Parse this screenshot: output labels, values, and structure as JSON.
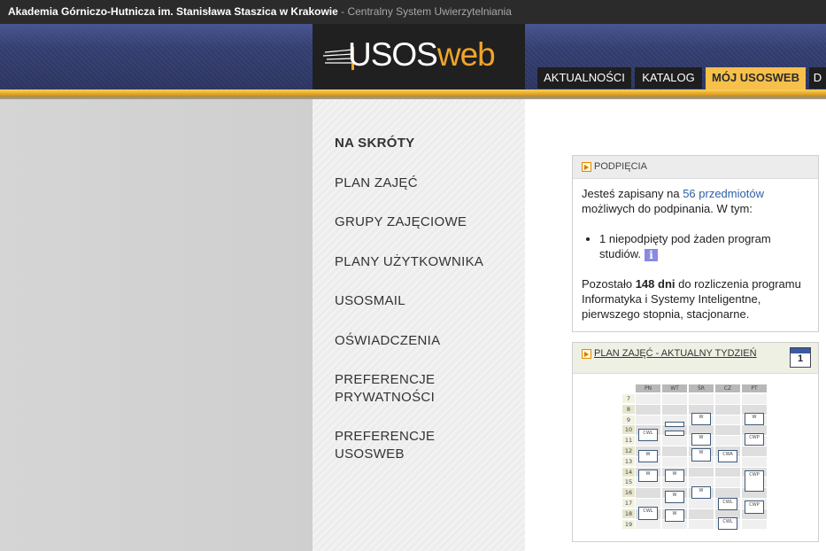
{
  "topbar": {
    "institution": "Akademia Górniczo-Hutnicza im. Stanisława Staszica w Krakowie",
    "system": " - Centralny System Uwierzytelniania"
  },
  "logo": {
    "part1": "USOS",
    "part2": "web"
  },
  "nav": {
    "tabs": [
      "AKTUALNOŚCI",
      "KATALOG",
      "MÓJ USOSWEB",
      "D"
    ],
    "active": "MÓJ USOSWEB"
  },
  "sidebar": {
    "items": [
      {
        "line1": "NA SKRÓTY",
        "line2": ""
      },
      {
        "line1": "PLAN ZAJĘĆ",
        "line2": ""
      },
      {
        "line1": "GRUPY ZAJĘCIOWE",
        "line2": ""
      },
      {
        "line1": "PLANY UŻYTKOWNIKA",
        "line2": ""
      },
      {
        "line1": "USOSMAIL",
        "line2": ""
      },
      {
        "line1": "OŚWIADCZENIA",
        "line2": ""
      },
      {
        "line1": "PREFERENCJE",
        "line2": "PRYWATNOŚCI"
      },
      {
        "line1": "PREFERENCJE",
        "line2": "USOSWEB"
      }
    ]
  },
  "panel_subscriptions": {
    "title": "PODPIĘCIA",
    "text1": "Jesteś zapisany na ",
    "link": "56 przedmiotów",
    "text2": " możliwych do podpinania. W tym:",
    "bullet": "1 niepodpięty pod żaden program studiów.",
    "info_icon": "i",
    "remaining_prefix": "Pozostało ",
    "remaining_days": "148 dni",
    "remaining_suffix": " do rozliczenia programu Informatyka i Systemy Inteligentne, pierwszego stopnia, stacjonarne."
  },
  "panel_plan": {
    "title": "PLAN ZAJĘĆ - AKTUALNY TYDZIEŃ",
    "calendar_day": "1",
    "days": [
      "PN",
      "WT",
      "ŚR",
      "CZ",
      "PT"
    ],
    "hours": [
      "7",
      "8",
      "9",
      "10",
      "11",
      "12",
      "13",
      "14",
      "15",
      "16",
      "17",
      "18",
      "19"
    ],
    "events": [
      "CWL",
      "W",
      "W",
      "W",
      "CWL",
      "W",
      "W",
      "W",
      "W",
      "W",
      "CWA",
      "CWP",
      "CWL",
      "CWP",
      "CWL",
      "W",
      "CWP",
      "CWL",
      "W"
    ]
  }
}
